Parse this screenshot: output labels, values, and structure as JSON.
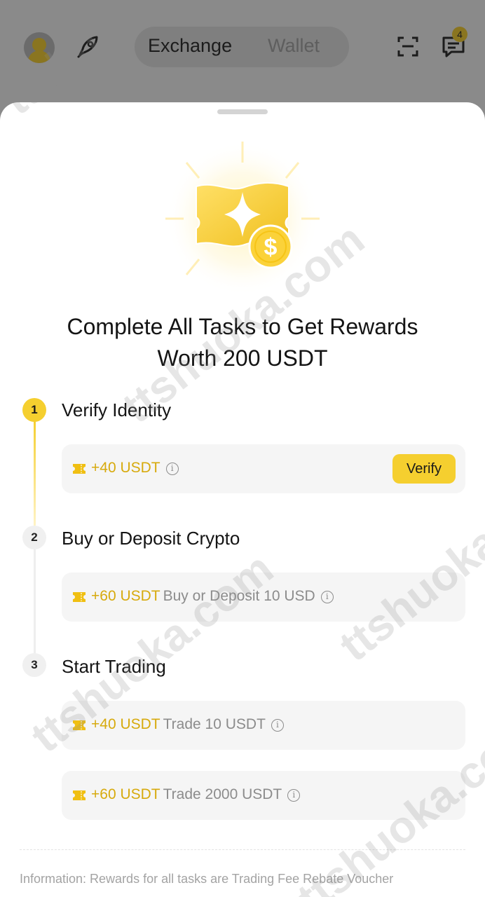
{
  "header": {
    "tabs": [
      {
        "label": "Exchange",
        "active": true
      },
      {
        "label": "Wallet",
        "active": false
      }
    ],
    "message_badge": "4",
    "icons": [
      "avatar",
      "rocket-icon",
      "scan-icon",
      "message-icon"
    ]
  },
  "sheet": {
    "title_line1": "Complete All Tasks to Get Rewards",
    "title_line2": "Worth 200 USDT",
    "steps": [
      {
        "number": "1",
        "title": "Verify Identity",
        "status": "active",
        "tasks": [
          {
            "reward": "+40 USDT",
            "description": "",
            "button": "Verify"
          }
        ]
      },
      {
        "number": "2",
        "title": "Buy or Deposit Crypto",
        "status": "todo",
        "tasks": [
          {
            "reward": "+60 USDT",
            "description": "Buy or Deposit 10 USD"
          }
        ]
      },
      {
        "number": "3",
        "title": "Start Trading",
        "status": "todo",
        "tasks": [
          {
            "reward": "+40 USDT",
            "description": "Trade 10 USDT"
          },
          {
            "reward": "+60 USDT",
            "description": "Trade 2000 USDT"
          }
        ]
      }
    ],
    "info_note": "Information: Rewards for all tasks are Trading Fee Rebate Voucher"
  },
  "watermark": "ttshuoka.com",
  "colors": {
    "accent": "#f5cf2f",
    "reward_text": "#d7aa0d",
    "card_bg": "#f5f5f5",
    "overlay_bg": "#8a8a8a"
  }
}
